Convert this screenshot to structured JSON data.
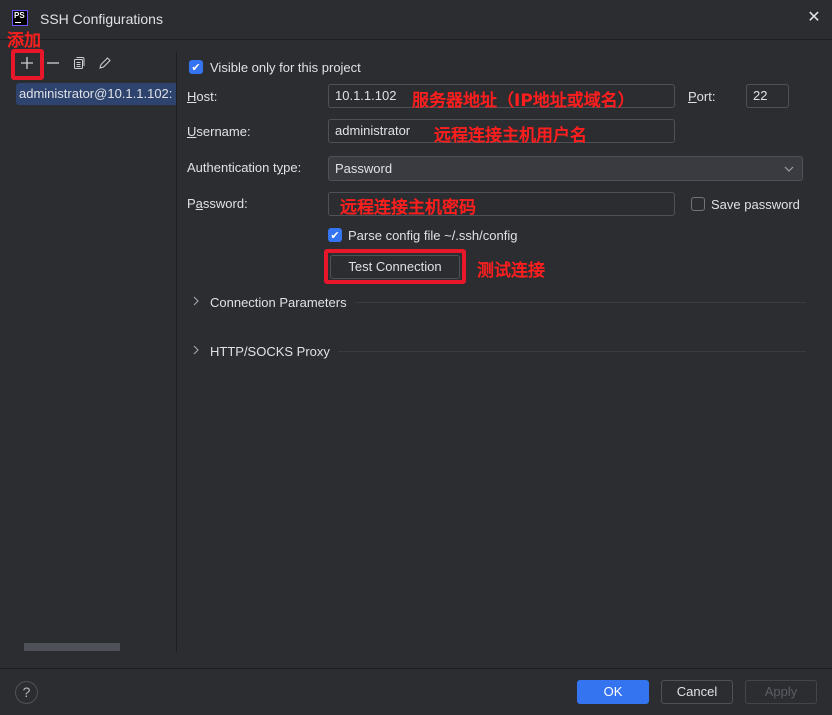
{
  "window": {
    "title": "SSH Configurations",
    "app_icon": "phpstorm-logo",
    "app_icon_text": "PS",
    "close_icon": "close-icon"
  },
  "annotations": {
    "add": "添加",
    "host": "服务器地址（IP地址或域名）",
    "username": "远程连接主机用户名",
    "password": "远程连接主机密码",
    "test": "测试连接",
    "color": "#ff1e1e"
  },
  "sidebar": {
    "toolbar": [
      {
        "name": "add",
        "icon": "plus-icon"
      },
      {
        "name": "remove",
        "icon": "minus-icon"
      },
      {
        "name": "copy",
        "icon": "copy-icon"
      },
      {
        "name": "edit",
        "icon": "pencil-icon"
      }
    ],
    "items": [
      {
        "label": "administrator@10.1.1.102:",
        "selected": true
      }
    ]
  },
  "form": {
    "visible_only": {
      "label": "Visible only for this project",
      "checked": true
    },
    "host": {
      "label_u": "H",
      "label_rest": "ost:",
      "value": "10.1.1.102"
    },
    "port": {
      "label_u": "P",
      "label_rest": "ort:",
      "value": "22"
    },
    "username": {
      "label_u": "U",
      "label_rest": "sername:",
      "value": "administrator"
    },
    "auth_type": {
      "label_pre": "Authentication t",
      "label_u": "y",
      "label_rest": "pe:",
      "value": "Password"
    },
    "password": {
      "label_pre": "P",
      "label_u": "a",
      "label_rest": "ssword:",
      "value": ""
    },
    "save_password": {
      "label": "Save password",
      "checked": false
    },
    "parse_config": {
      "label": "Parse config file ~/.ssh/config",
      "checked": true
    },
    "test_connection_label": "Test Connection",
    "sections": [
      {
        "label": "Connection Parameters",
        "expanded": false
      },
      {
        "label": "HTTP/SOCKS Proxy",
        "expanded": false
      }
    ]
  },
  "footer": {
    "help_label": "?",
    "ok_label": "OK",
    "cancel_label": "Cancel",
    "apply_label": "Apply",
    "apply_enabled": false,
    "accent_color": "#3574f0"
  }
}
